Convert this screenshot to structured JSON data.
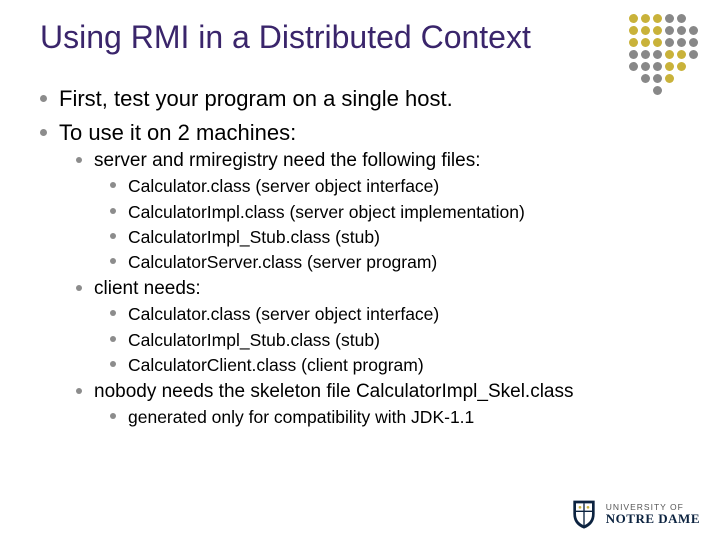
{
  "title": "Using RMI in a Distributed Context",
  "bullets": {
    "b0": "First, test your program on a single host.",
    "b1": "To use it on 2 machines:",
    "b1_0": "server and rmiregistry need the following files:",
    "b1_0_0": "Calculator.class (server object interface)",
    "b1_0_1": "CalculatorImpl.class (server object implementation)",
    "b1_0_2": "CalculatorImpl_Stub.class (stub)",
    "b1_0_3": "CalculatorServer.class (server program)",
    "b1_1": "client needs:",
    "b1_1_0": "Calculator.class (server object interface)",
    "b1_1_1": "CalculatorImpl_Stub.class (stub)",
    "b1_1_2": "CalculatorClient.class (client program)",
    "b1_2": "nobody needs the skeleton file CalculatorImpl_Skel.class",
    "b1_2_0": "generated only for compatibility with JDK-1.1"
  },
  "logo": {
    "sub": "UNIVERSITY OF",
    "main": "NOTRE DAME"
  }
}
